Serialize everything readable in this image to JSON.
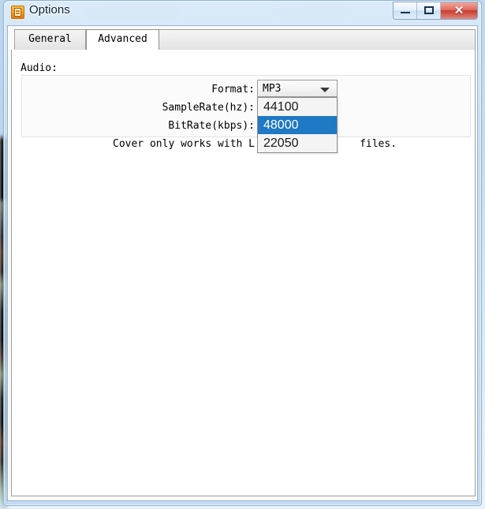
{
  "window": {
    "title": "Options",
    "icon": "app-icon",
    "controls": {
      "minimize_label": "—",
      "maximize_label": "□",
      "close_label": "✕"
    }
  },
  "tabs": [
    {
      "label": "General",
      "active": false
    },
    {
      "label": "Advanced",
      "active": true
    }
  ],
  "advanced": {
    "group_label": "Audio:",
    "fields": {
      "format_label": "Format:",
      "samplerate_label": "SampleRate(hz):",
      "bitrate_label": "BitRate(kbps):"
    },
    "format_combo": {
      "value": "MP3",
      "arrow_icon": "chevron-down-icon",
      "expanded": true,
      "options": [
        {
          "label": "44100",
          "selected": false
        },
        {
          "label": "48000",
          "selected": true
        },
        {
          "label": "22050",
          "selected": false
        }
      ]
    },
    "note": "Cover only works with L                 files."
  },
  "colors": {
    "accent_selected": "#2079c4",
    "close_button": "#c8392c",
    "titlebar_glass": "#cde3f6",
    "client_background": "#fafafa"
  }
}
